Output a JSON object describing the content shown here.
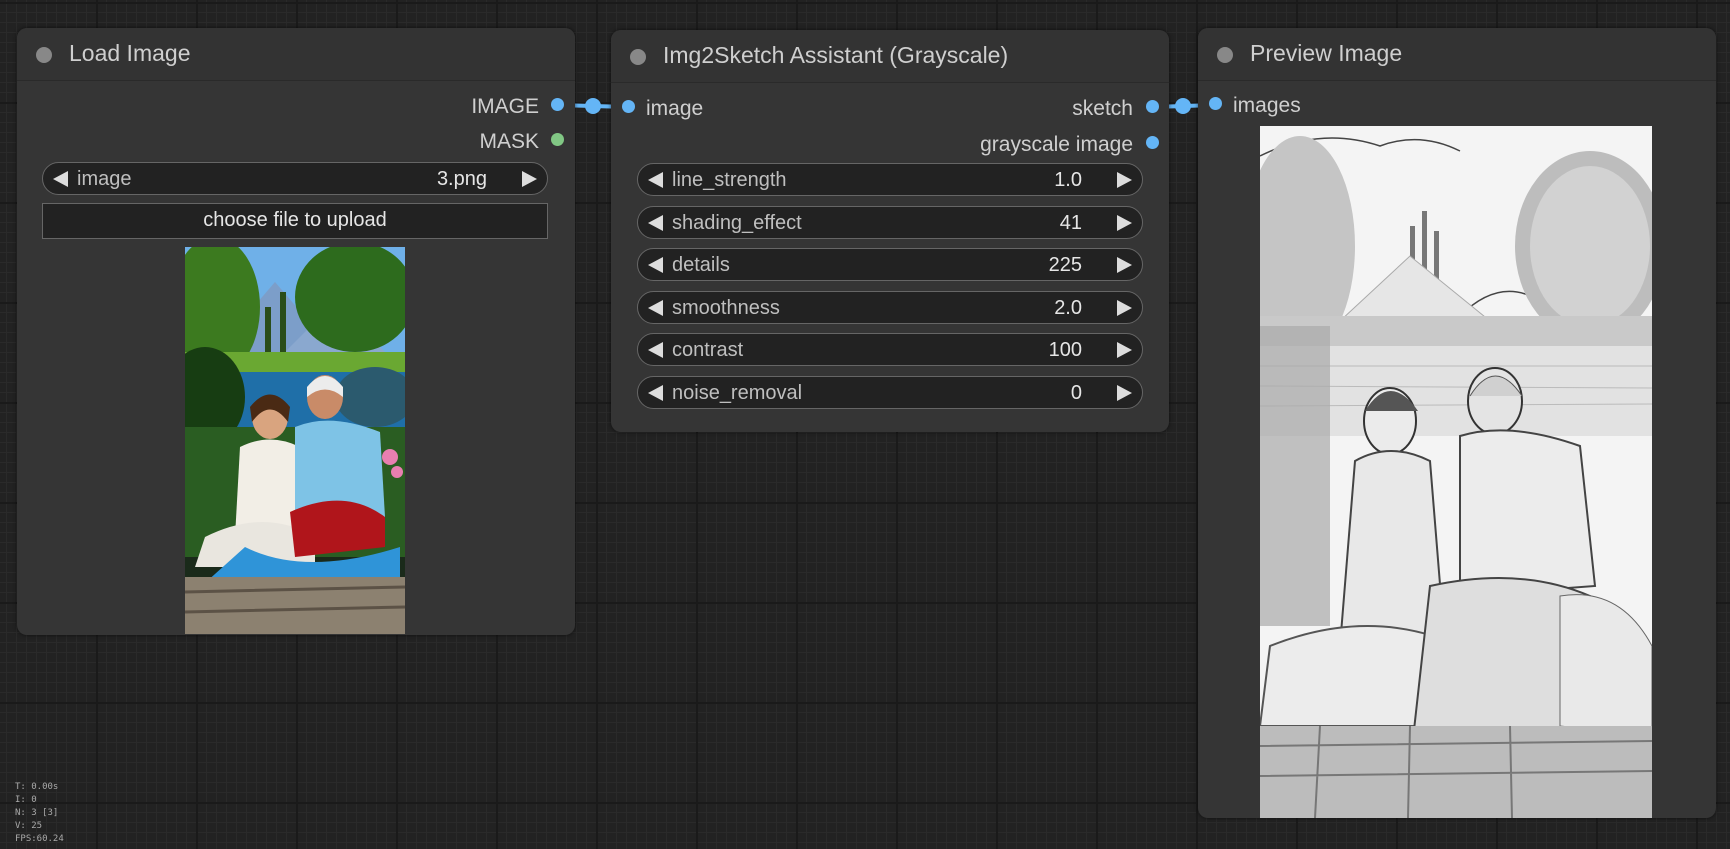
{
  "nodes": {
    "load_image": {
      "title": "Load Image",
      "outputs": [
        "IMAGE",
        "MASK"
      ],
      "widget": {
        "name": "image",
        "value": "3.png"
      },
      "upload_label": "choose file to upload"
    },
    "sketch": {
      "title": "Img2Sketch Assistant (Grayscale)",
      "input": "image",
      "outputs": [
        "sketch",
        "grayscale image"
      ],
      "widgets": [
        {
          "name": "line_strength",
          "value": "1.0"
        },
        {
          "name": "shading_effect",
          "value": "41"
        },
        {
          "name": "details",
          "value": "225"
        },
        {
          "name": "smoothness",
          "value": "2.0"
        },
        {
          "name": "contrast",
          "value": "100"
        },
        {
          "name": "noise_removal",
          "value": "0"
        }
      ]
    },
    "preview": {
      "title": "Preview Image",
      "input": "images"
    }
  },
  "stats": [
    "T: 0.00s",
    "I: 0",
    "N: 3 [3]",
    "V: 25",
    "FPS:60.24"
  ],
  "colors": {
    "image_slot": "#64b5f6",
    "mask_slot": "#81c784",
    "link": "#64b5f6",
    "title_dot": "#888888"
  },
  "icons": [
    "link-dot",
    "arrow-left-icon",
    "arrow-right-icon"
  ]
}
